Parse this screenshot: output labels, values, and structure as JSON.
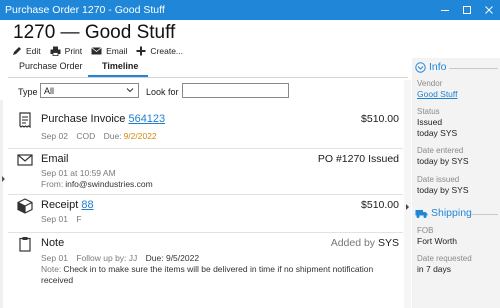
{
  "window": {
    "title": "Purchase Order 1270 - Good Stuff"
  },
  "header": {
    "title": "1270 — Good Stuff"
  },
  "actions": [
    {
      "label": "Edit",
      "icon": "pencil-icon"
    },
    {
      "label": "Print",
      "icon": "printer-icon"
    },
    {
      "label": "Email",
      "icon": "envelope-icon"
    },
    {
      "label": "Create...",
      "icon": "plus-icon"
    }
  ],
  "tabs": [
    {
      "label": "Purchase Order",
      "active": false
    },
    {
      "label": "Timeline",
      "active": true
    }
  ],
  "filter": {
    "type_label": "Type",
    "type_value": "All",
    "look_for_label": "Look for",
    "look_for_value": ""
  },
  "timeline": [
    {
      "kind": "Purchase Invoice",
      "icon": "invoice-icon",
      "link": "564123",
      "right": "$510.00",
      "meta": [
        "Sep 02",
        "COD",
        "Due:"
      ],
      "meta_highlight": "9/2/2022"
    },
    {
      "kind": "Email",
      "icon": "envelope-icon",
      "right": "PO #1270 Issued",
      "meta_line1": "Sep 01 at 10:59 AM",
      "meta_line2_label": "From:",
      "meta_line2_value": "info@swindustries.com"
    },
    {
      "kind": "Receipt",
      "icon": "box-icon",
      "link": "88",
      "right": "$510.00",
      "meta": [
        "Sep 01",
        "F"
      ]
    },
    {
      "kind": "Note",
      "icon": "clipboard-icon",
      "right_label": "Added by",
      "right_value": "SYS",
      "meta": [
        "Sep 01",
        "Follow up by: JJ",
        "Due: 9/5/2022"
      ],
      "note_label": "Note:",
      "note_text_1": "Check in to make sure the items will be delivered in time if no shipment notification",
      "note_text_2": "received"
    }
  ],
  "info": {
    "title": "Info",
    "vendor_label": "Vendor",
    "vendor_value": "Good Stuff",
    "status_label": "Status",
    "status_value": "Issued",
    "status_sub": "today SYS",
    "date_entered_label": "Date entered",
    "date_entered_value": "today by SYS",
    "date_issued_label": "Date issued",
    "date_issued_value": "today by SYS"
  },
  "shipping": {
    "title": "Shipping",
    "fob_label": "FOB",
    "fob_value": "Fort Worth",
    "date_requested_label": "Date requested",
    "date_requested_value": "in 7 days"
  },
  "colors": {
    "accent": "#1f86d8",
    "link": "#1f7fd0",
    "due_highlight": "#d38a12"
  }
}
